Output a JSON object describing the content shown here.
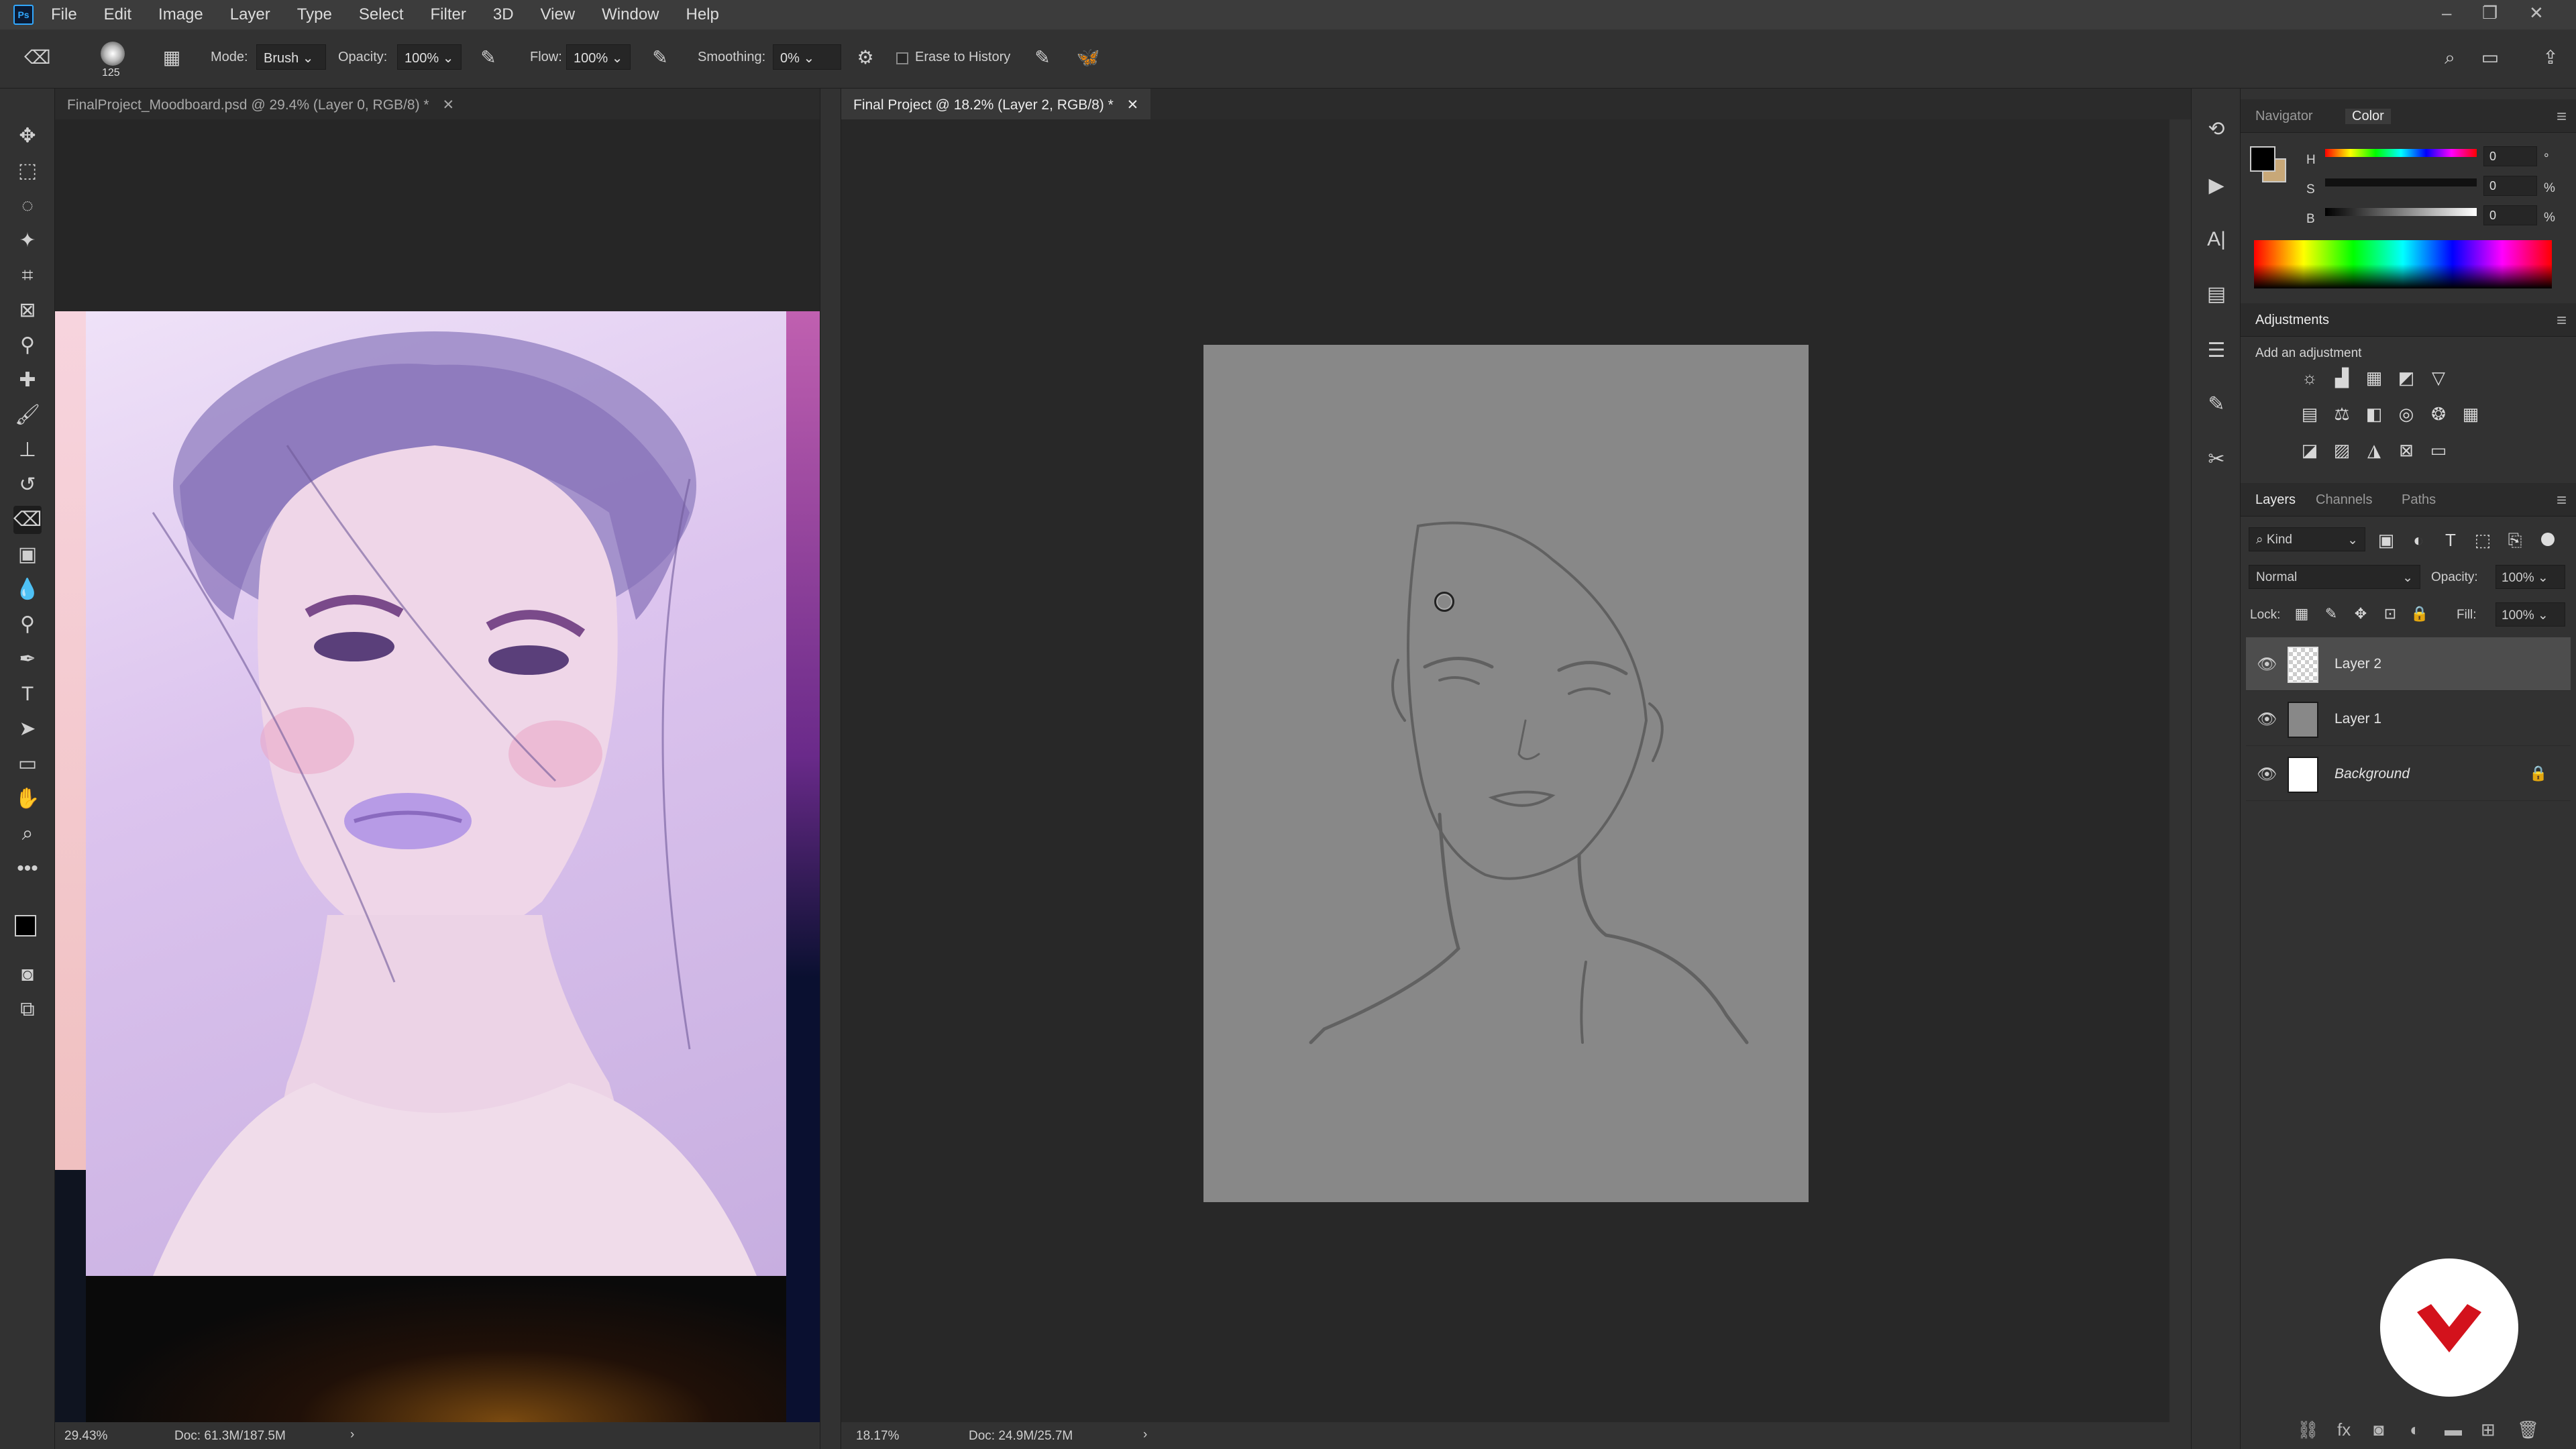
{
  "menu": {
    "logo": "Ps",
    "items": [
      "File",
      "Edit",
      "Image",
      "Layer",
      "Type",
      "Select",
      "Filter",
      "3D",
      "View",
      "Window",
      "Help"
    ]
  },
  "options_bar": {
    "brush_size": "125",
    "mode_label": "Mode:",
    "mode_value": "Brush",
    "opacity_label": "Opacity:",
    "opacity_value": "100%",
    "flow_label": "Flow:",
    "flow_value": "100%",
    "smoothing_label": "Smoothing:",
    "smoothing_value": "0%",
    "erase_history_label": "Erase to History"
  },
  "documents": {
    "left": {
      "tab_title": "FinalProject_Moodboard.psd @ 29.4% (Layer 0, RGB/8) *",
      "zoom": "29.43%",
      "doc_size": "Doc: 61.3M/187.5M"
    },
    "right": {
      "tab_title": "Final Project @ 18.2% (Layer 2, RGB/8) *",
      "zoom": "18.17%",
      "doc_size": "Doc: 24.9M/25.7M"
    }
  },
  "color_panel": {
    "tabs": [
      "Navigator",
      "Color"
    ],
    "active_tab": "Color",
    "h_label": "H",
    "s_label": "S",
    "b_label": "B",
    "h_value": "0",
    "s_value": "0",
    "b_value": "0",
    "h_unit": "°",
    "s_unit": "%",
    "b_unit": "%",
    "foreground": "#000000",
    "background": "#c8a878"
  },
  "adjustments_panel": {
    "title": "Adjustments",
    "subtitle": "Add an adjustment"
  },
  "layers_panel": {
    "tabs": [
      "Layers",
      "Channels",
      "Paths"
    ],
    "active_tab": "Layers",
    "filter_value": "Kind",
    "blend_mode": "Normal",
    "opacity_label": "Opacity:",
    "opacity_value": "100%",
    "lock_label": "Lock:",
    "fill_label": "Fill:",
    "fill_value": "100%",
    "layers": [
      {
        "name": "Layer 2",
        "selected": true,
        "visible": true
      },
      {
        "name": "Layer 1",
        "selected": false,
        "visible": true
      },
      {
        "name": "Background",
        "selected": false,
        "visible": true,
        "locked": true
      }
    ]
  },
  "colors": {
    "accent": "#31a8ff",
    "brand_badge": "#d3121c"
  }
}
